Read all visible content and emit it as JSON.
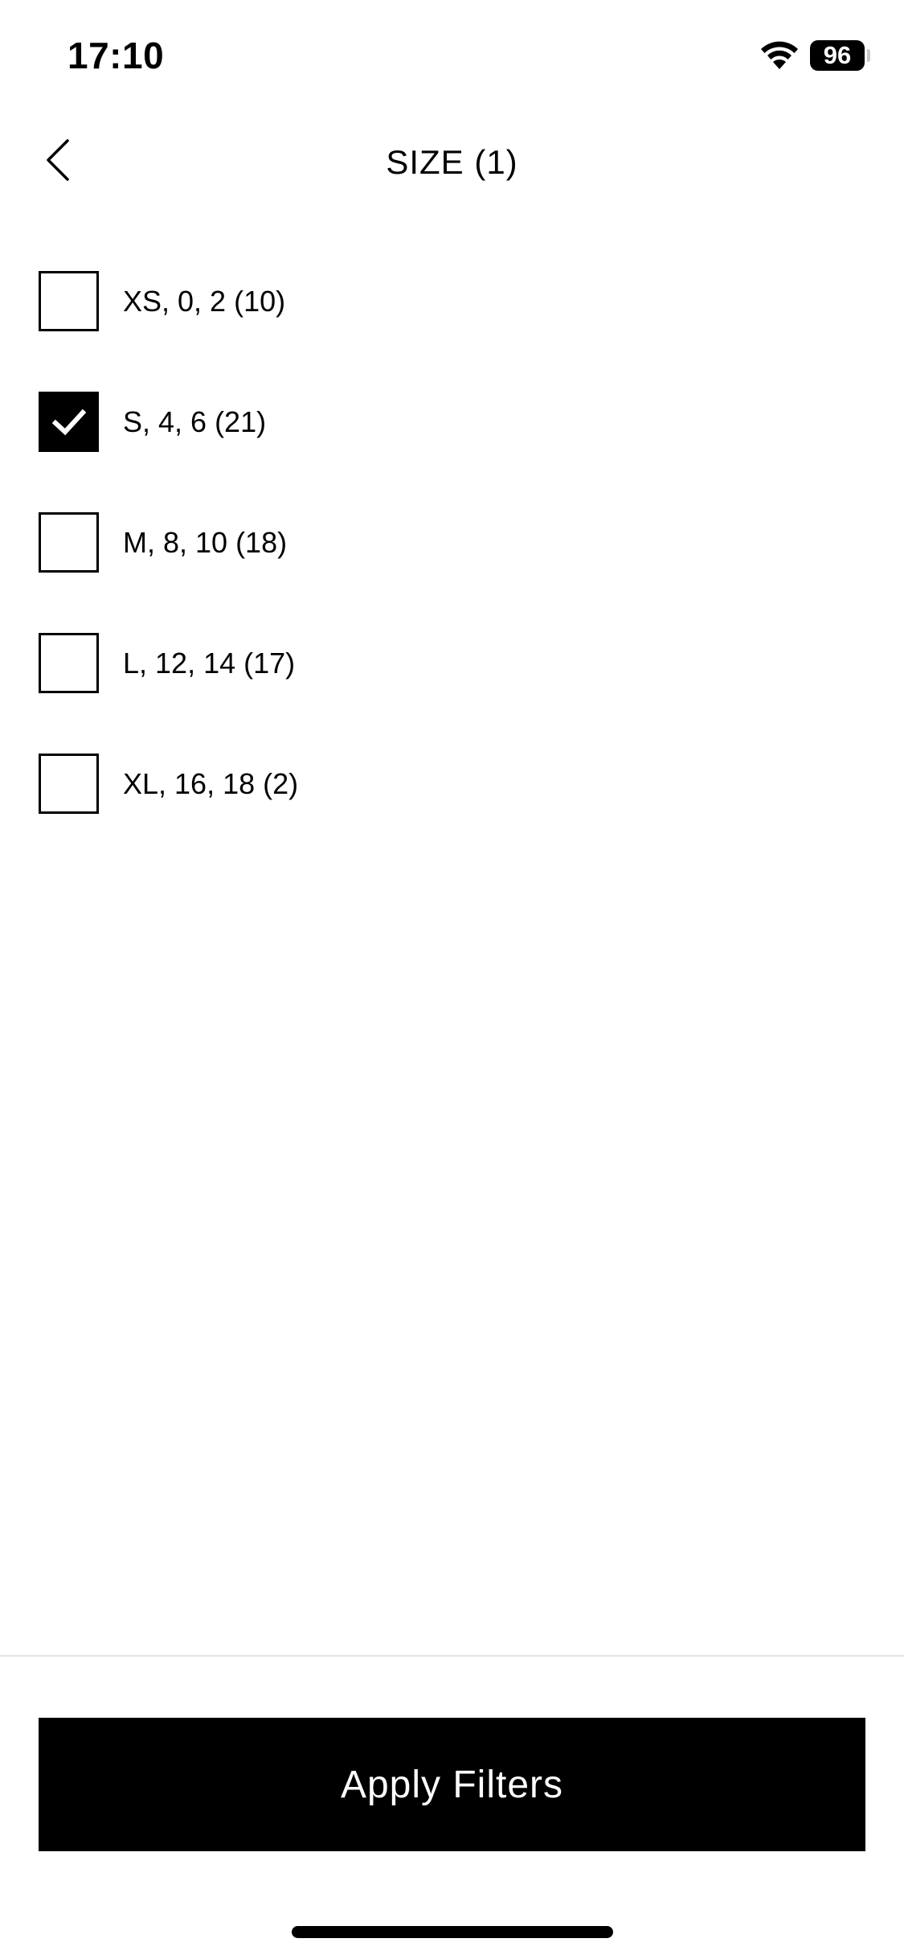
{
  "status_bar": {
    "time": "17:10",
    "battery": "96",
    "wifi_icon": "wifi-icon"
  },
  "header": {
    "title": "SIZE (1)",
    "back_icon": "chevron-left-icon"
  },
  "options": [
    {
      "label": "XS, 0, 2 (10)",
      "checked": false
    },
    {
      "label": "S, 4, 6 (21)",
      "checked": true
    },
    {
      "label": "M, 8, 10 (18)",
      "checked": false
    },
    {
      "label": "L, 12, 14 (17)",
      "checked": false
    },
    {
      "label": "XL, 16, 18 (2)",
      "checked": false
    }
  ],
  "footer": {
    "apply_label": "Apply Filters"
  },
  "colors": {
    "primary": "#000000",
    "background": "#ffffff",
    "divider": "#e3e3e8"
  }
}
